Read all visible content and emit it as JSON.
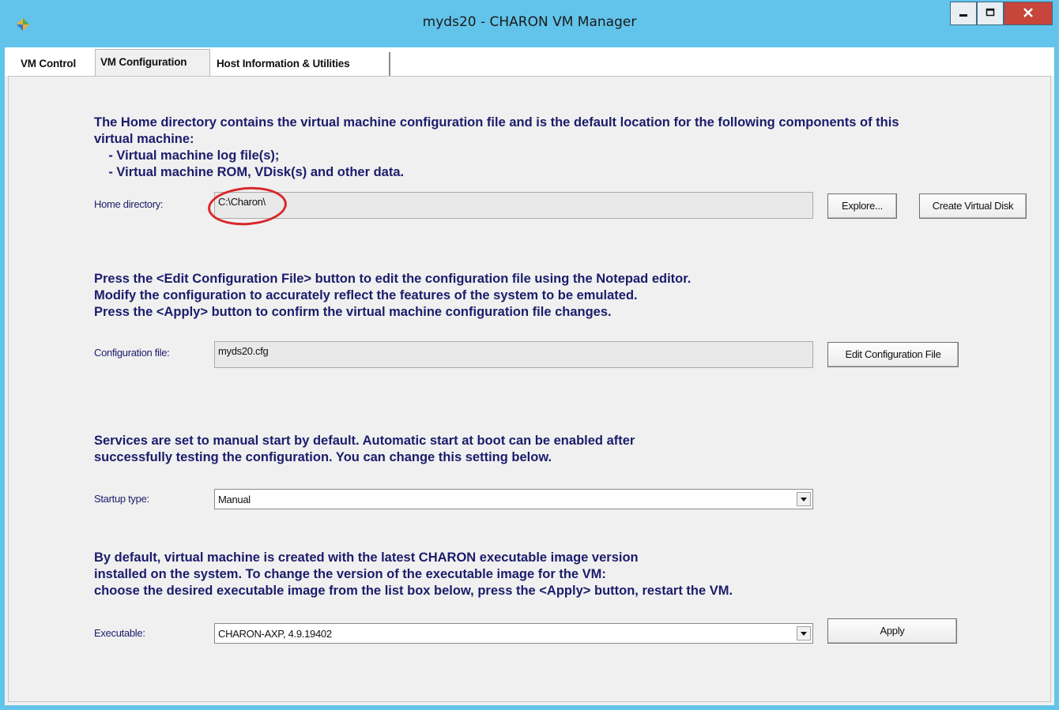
{
  "window": {
    "title": "myds20 - CHARON VM Manager",
    "icon": "app-logo-icon",
    "controls": {
      "minimize": "minimize-icon",
      "maximize": "maximize-icon",
      "close": "close-icon"
    }
  },
  "tabs": [
    {
      "label": "VM Control",
      "active": false
    },
    {
      "label": "VM Configuration",
      "active": true
    },
    {
      "label": "Host Information & Utilities",
      "active": false
    }
  ],
  "home": {
    "info": "The Home directory contains the virtual machine configuration file and is the default location for the following components of this\nvirtual machine:\n    - Virtual machine log file(s);\n    - Virtual machine ROM, VDisk(s) and other data.",
    "label": "Home directory:",
    "value": "C:\\Charon\\",
    "explore_label": "Explore...",
    "create_disk_label": "Create Virtual Disk"
  },
  "config": {
    "info": "Press the <Edit Configuration File> button to edit the configuration file using the Notepad editor.\nModify the configuration to accurately reflect the features of the system to be emulated.\nPress the <Apply> button to confirm the virtual machine configuration file changes.",
    "label": "Configuration file:",
    "value": "myds20.cfg",
    "edit_label": "Edit Configuration File"
  },
  "startup": {
    "info": "Services are set to manual start by default. Automatic start at boot can be enabled after\nsuccessfully testing the configuration. You can change this setting below.",
    "label": "Startup type:",
    "value": "Manual"
  },
  "executable": {
    "info": "By default, virtual machine is created with the latest CHARON executable image version\ninstalled on the system. To change the version of the executable image for the VM:\nchoose the desired executable image from the list box below, press the <Apply> button, restart the VM.",
    "label": "Executable:",
    "value": "CHARON-AXP, 4.9.19402",
    "apply_label": "Apply"
  },
  "colors": {
    "titlebar": "#62c4ea",
    "info_text": "#1c1c6c",
    "annotation": "#d7282c",
    "close_button": "#c7453a"
  }
}
